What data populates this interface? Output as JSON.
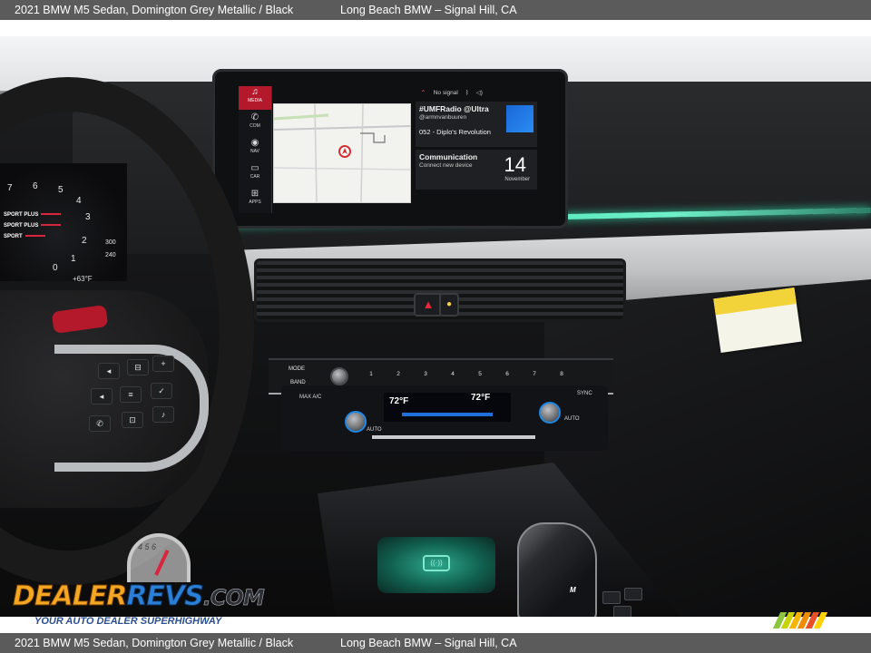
{
  "caption": {
    "vehicle": "2021 BMW M5 Sedan,  Domington Grey Metallic / Black",
    "dealer": "Long Beach BMW – Signal Hill, CA"
  },
  "screen": {
    "sidebar": [
      {
        "label": "MEDIA",
        "icon": "music-note-icon",
        "glyph": "♫",
        "active": true
      },
      {
        "label": "COM",
        "icon": "phone-icon",
        "glyph": "✆",
        "active": false
      },
      {
        "label": "NAV",
        "icon": "compass-icon",
        "glyph": "◉",
        "active": false
      },
      {
        "label": "CAR",
        "icon": "car-icon",
        "glyph": "▭",
        "active": false
      },
      {
        "label": "APPS",
        "icon": "apps-grid-icon",
        "glyph": "⊞",
        "active": false
      }
    ],
    "status": {
      "signal": "No signal"
    },
    "radio_widget": {
      "title": "#UMFRadio @Ultra",
      "handle": "@armnvanbuuren",
      "track": "052 - Diplo's Revolution"
    },
    "comm_widget": {
      "title": "Communication",
      "subtitle": "Connect new device",
      "date_day": "14",
      "date_month": "November"
    }
  },
  "cluster": {
    "numbers": [
      "7",
      "6",
      "5",
      "4",
      "3",
      "2",
      "1",
      "0"
    ],
    "drive_modes": [
      "SPORT PLUS",
      "SPORT PLUS",
      "SPORT"
    ],
    "outside_temp": "+63°F",
    "speed_marks": [
      "300",
      "240"
    ]
  },
  "center_stack": {
    "mode_label": "MODE",
    "band_label": "BAND",
    "presets": [
      "1",
      "2",
      "3",
      "4",
      "5",
      "6",
      "7",
      "8"
    ],
    "temp_left": "72°F",
    "temp_right": "72°F",
    "max_ac_label": "MAX A/C",
    "auto_left": "AUTO",
    "auto_right": "AUTO",
    "sync_label": "SYNC"
  },
  "console": {
    "gear_badge": "M"
  },
  "watermark": {
    "logo_dealer": "DEALER",
    "logo_revs": "REVS",
    "logo_com": ".COM",
    "tagline": "YOUR AUTO DEALER SUPERHIGHWAY",
    "gauge_numbers": "4 5 6",
    "stripe_colors": [
      "#8cc63f",
      "#c8d400",
      "#f7b500",
      "#f08c00",
      "#e8502a",
      "#ffd200"
    ]
  }
}
